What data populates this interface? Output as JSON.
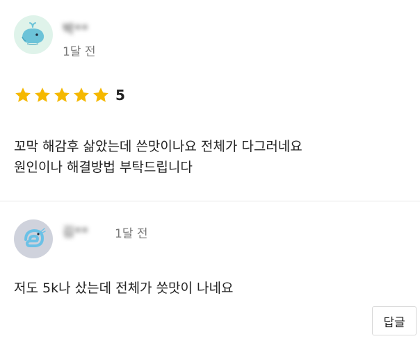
{
  "reviews": [
    {
      "author": "박**",
      "time": "1달 전",
      "rating_value": 5,
      "rating_label": "5",
      "text_line1": "꼬막 해감후 삶았는데 쓴맛이나요 전체가 다그러네요",
      "text_line2": "원인이나 해결방법 부탁드립니다",
      "avatar_icon": "whale-icon",
      "avatar_bg": "#dff3ea"
    },
    {
      "author": "김**",
      "time": "1달 전",
      "text_line1": "저도 5k나 샀는데 전체가 씃맛이 나네요",
      "avatar_icon": "shrimp-icon",
      "avatar_bg": "#cfd2dc"
    }
  ],
  "reply_button": "답글",
  "colors": {
    "star": "#f5b800",
    "divider": "#e6e6e6"
  }
}
